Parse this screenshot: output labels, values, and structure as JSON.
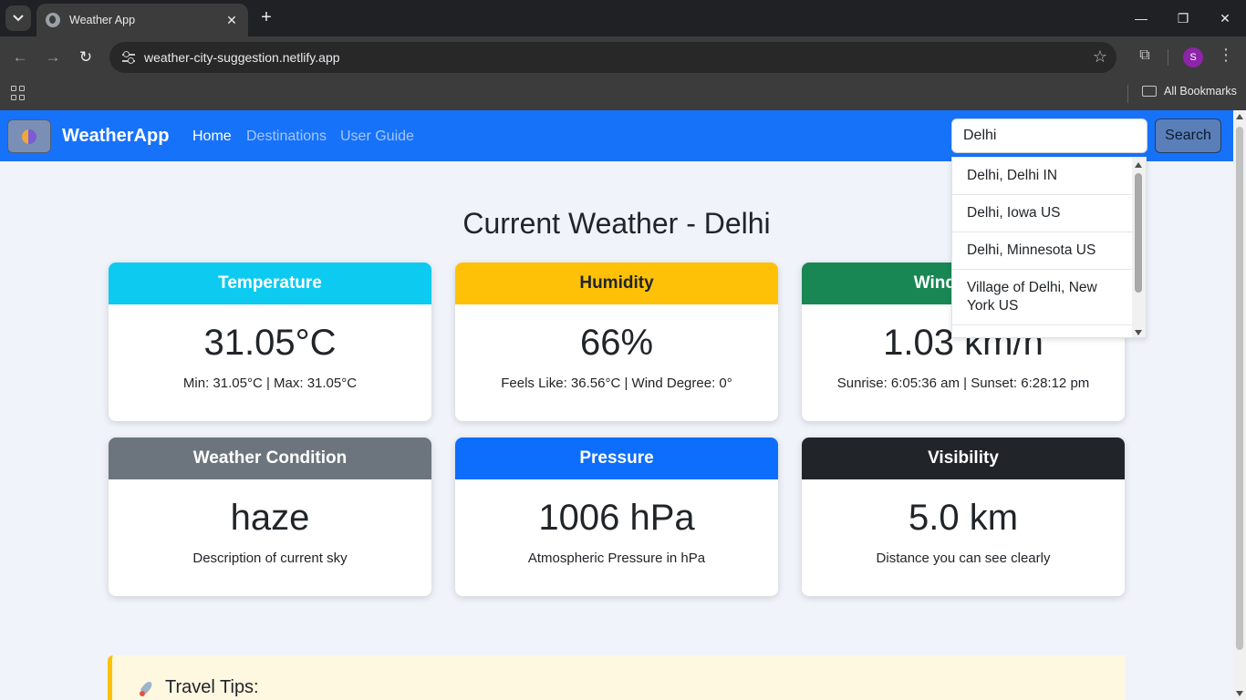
{
  "browser": {
    "tab_title": "Weather App",
    "url": "weather-city-suggestion.netlify.app",
    "bookmarks_label": "All Bookmarks",
    "profile_initial": "S"
  },
  "navbar": {
    "brand": "WeatherApp",
    "links": [
      "Home",
      "Destinations",
      "User Guide"
    ],
    "active_link": "Home",
    "search_value": "Delhi",
    "search_button": "Search"
  },
  "suggestions": [
    "Delhi, Delhi IN",
    "Delhi, Iowa US",
    "Delhi, Minnesota US",
    "Village of Delhi, New York US"
  ],
  "main": {
    "heading": "Current Weather - Delhi",
    "cards": [
      {
        "title": "Temperature",
        "value": "31.05°C",
        "sub": "Min: 31.05°C | Max: 31.05°C",
        "header_color": "#0dcaf0",
        "header_text": "#ffffff"
      },
      {
        "title": "Humidity",
        "value": "66%",
        "sub": "Feels Like: 36.56°C | Wind Degree: 0°",
        "header_color": "#ffc107",
        "header_text": "#212529"
      },
      {
        "title": "Wind Speed",
        "value": "1.03 km/h",
        "sub": "Sunrise: 6:05:36 am | Sunset: 6:28:12 pm",
        "header_color": "#198754",
        "header_text": "#ffffff"
      },
      {
        "title": "Weather Condition",
        "value": "haze",
        "sub": "Description of current sky",
        "header_color": "#6c757d",
        "header_text": "#ffffff"
      },
      {
        "title": "Pressure",
        "value": "1006 hPa",
        "sub": "Atmospheric Pressure in hPa",
        "header_color": "#0d6efd",
        "header_text": "#ffffff"
      },
      {
        "title": "Visibility",
        "value": "5.0 km",
        "sub": "Distance you can see clearly",
        "header_color": "#212529",
        "header_text": "#ffffff"
      }
    ],
    "tips_title": "Travel Tips:"
  }
}
